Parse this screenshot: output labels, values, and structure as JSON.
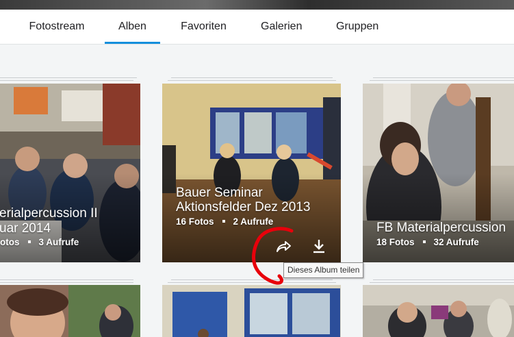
{
  "nav": {
    "tabs": [
      {
        "label": "Fotostream"
      },
      {
        "label": "Alben",
        "active": true
      },
      {
        "label": "Favoriten"
      },
      {
        "label": "Galerien"
      },
      {
        "label": "Gruppen"
      }
    ],
    "accent_color": "#128fdc"
  },
  "albums": [
    {
      "title_line1": "erialpercussion II",
      "title_line2": "uar 2014",
      "photos": "otos",
      "views": "3 Aufrufe"
    },
    {
      "title_line1": "Bauer Seminar",
      "title_line2": "Aktionsfelder Dez 2013",
      "photos": "16 Fotos",
      "views": "2 Aufrufe",
      "actions": {
        "share": "share-icon",
        "download": "download-icon"
      }
    },
    {
      "title_line1": "FB Materialpercussion",
      "photos": "18 Fotos",
      "views": "32 Aufrufe"
    }
  ],
  "tooltip": {
    "text": "Dieses Album teilen"
  },
  "annotation_color": "#e8000b"
}
